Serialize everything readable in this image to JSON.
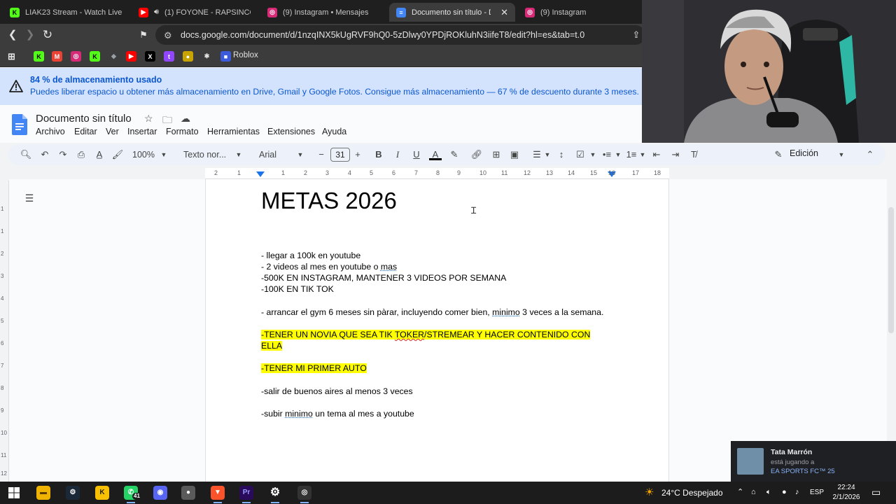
{
  "browser": {
    "tabs": [
      {
        "label": "LIAK23 Stream - Watch Live",
        "color": "#53fc18",
        "glyph": "K"
      },
      {
        "label": "(1) FOYONE - RAPSINCORTE",
        "color": "#ff0000",
        "glyph": "▶"
      },
      {
        "label": "(9) Instagram • Mensajes",
        "color": "#d62976",
        "glyph": "◎"
      },
      {
        "label": "Documento sin título - Doc",
        "color": "#4285f4",
        "glyph": "≡"
      },
      {
        "label": "(9) Instagram",
        "color": "#d62976",
        "glyph": "◎"
      }
    ],
    "url": "docs.google.com/document/d/1nzqINX5kUgRVF9hQ0-5zDlwy0YPDjROKluhN3iifeT8/edit?hl=es&tab=t.0",
    "bookmark_label": "Roblox"
  },
  "banner": {
    "title": "84 % de almacenamiento usado",
    "message": "Puedes liberar espacio u obtener más almacenamiento en Drive, Gmail y Google Fotos. Consigue más almacenamiento — 67 % de descuento durante 3 meses."
  },
  "docs": {
    "title": "Documento sin título",
    "menu": [
      "Archivo",
      "Editar",
      "Ver",
      "Insertar",
      "Formato",
      "Herramientas",
      "Extensiones",
      "Ayuda"
    ],
    "toolbar": {
      "zoom": "100%",
      "style": "Texto nor...",
      "font": "Arial",
      "font_size": "31",
      "mode": "Edición"
    },
    "ruler_numbers": [
      "2",
      "1",
      "1",
      "2",
      "3",
      "4",
      "5",
      "6",
      "7",
      "8",
      "9",
      "10",
      "11",
      "12",
      "13",
      "14",
      "15",
      "16",
      "17",
      "18"
    ],
    "vruler_numbers": [
      "1",
      "1",
      "2",
      "3",
      "4",
      "5",
      "6",
      "7",
      "8",
      "9",
      "10",
      "11",
      "12",
      "13"
    ]
  },
  "document": {
    "heading": "METAS 2026",
    "lines": [
      {
        "text": "- llegar a 100k en youtube"
      },
      {
        "text_a": "- 2 videos al mes en youtube o ",
        "text_b": "mas"
      },
      {
        "text": "-500K EN INSTAGRAM, MANTENER 3 VIDEOS POR SEMANA"
      },
      {
        "text": "-100K EN TIK TOK"
      },
      {
        "text_a": "- arrancar el gym 6 meses sin pàrar, incluyendo comer bien, ",
        "text_b": "minimo",
        "text_c": " 3 veces a la semana."
      },
      {
        "text_a": "-TENER UN NOVIA QUE SEA TIK ",
        "text_b": "TOKER",
        "text_c": "/STREMEAR Y HACER CONTENIDO CON"
      },
      {
        "text": "ELLA"
      },
      {
        "text": "-TENER MI PRIMER AUTO"
      },
      {
        "text": "-salir de buenos aires al menos 3 veces"
      },
      {
        "text_a": "-subir ",
        "text_b": "minimo",
        "text_c": " un tema al mes a youtube"
      }
    ]
  },
  "notification": {
    "name": "Tata Marrón",
    "status": "está jugando a",
    "game": "EA SPORTS FC™ 25"
  },
  "taskbar": {
    "badge": "41",
    "weather": "24°C  Despejado",
    "lang": "ESP",
    "time": "22:24",
    "date": "2/1/2026"
  }
}
